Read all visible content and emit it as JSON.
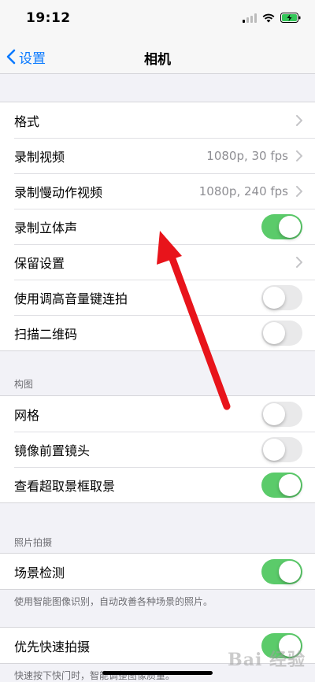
{
  "status": {
    "time": "19:12"
  },
  "nav": {
    "back_label": "设置",
    "title": "相机"
  },
  "group1": {
    "rows": [
      {
        "label": "格式"
      },
      {
        "label": "录制视频",
        "value": "1080p, 30 fps"
      },
      {
        "label": "录制慢动作视频",
        "value": "1080p, 240 fps"
      },
      {
        "label": "录制立体声",
        "toggle": true
      },
      {
        "label": "保留设置"
      },
      {
        "label": "使用调高音量键连拍",
        "toggle": false
      },
      {
        "label": "扫描二维码",
        "toggle": false
      }
    ]
  },
  "composition": {
    "header": "构图",
    "rows": [
      {
        "label": "网格",
        "toggle": false
      },
      {
        "label": "镜像前置镜头",
        "toggle": false
      },
      {
        "label": "查看超取景框取景",
        "toggle": true
      }
    ]
  },
  "photo_capture": {
    "header": "照片拍摄",
    "rows": [
      {
        "label": "场景检测",
        "toggle": true
      }
    ],
    "footer": "使用智能图像识别，自动改善各种场景的照片。"
  },
  "fast_capture": {
    "rows": [
      {
        "label": "优先快速拍摄",
        "toggle": true
      }
    ],
    "footer": "快速按下快门时，智能调整图像质量。"
  },
  "watermark_text": "Bai 经验",
  "colors": {
    "accent": "#0a7aff",
    "toggle_on": "#5bcb6a",
    "arrow": "#e8141b"
  }
}
